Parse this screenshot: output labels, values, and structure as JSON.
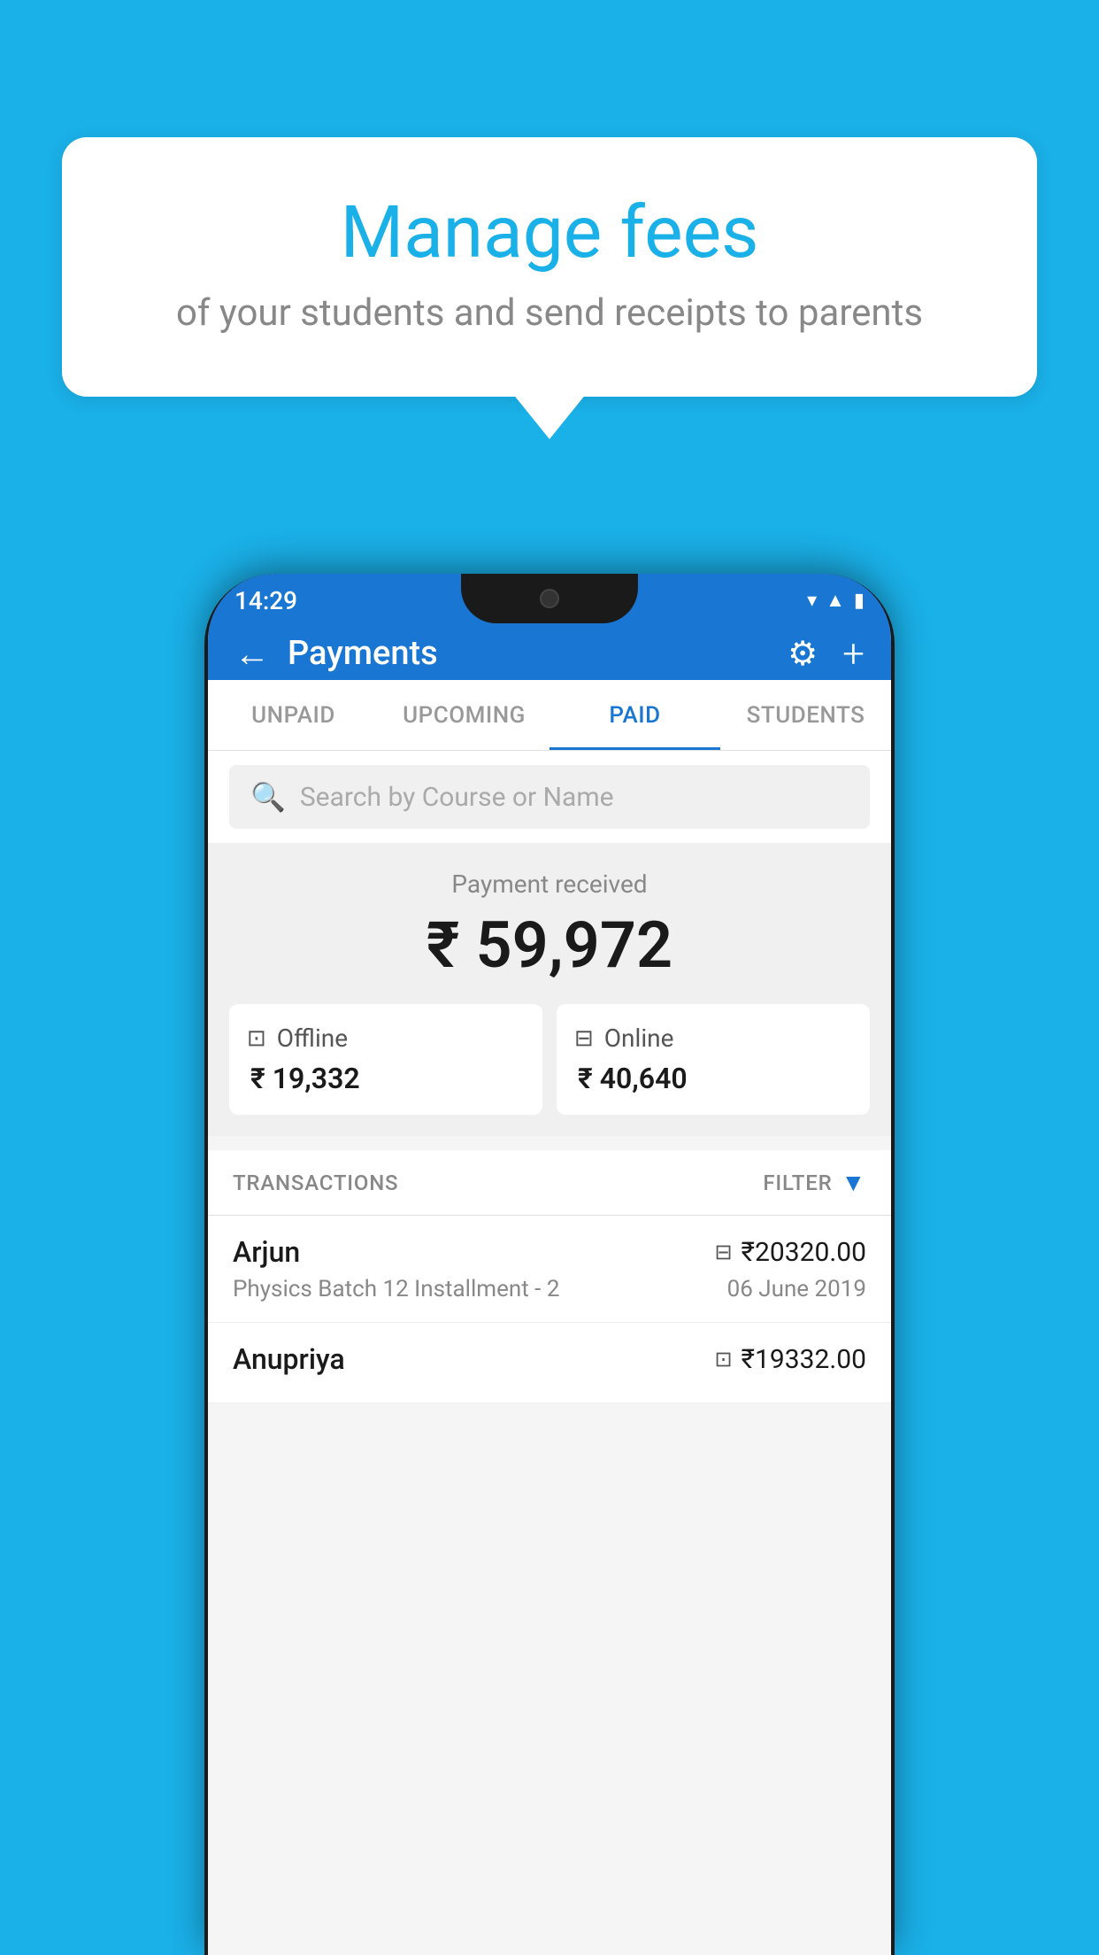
{
  "page": {
    "background_color": "#1ab0e8"
  },
  "speech_bubble": {
    "title": "Manage fees",
    "subtitle": "of your students and send receipts to parents"
  },
  "status_bar": {
    "time": "14:29",
    "icons": [
      "wifi",
      "signal",
      "battery"
    ]
  },
  "header": {
    "title": "Payments",
    "back_label": "←",
    "settings_label": "⚙",
    "add_label": "+"
  },
  "tabs": [
    {
      "label": "UNPAID",
      "active": false
    },
    {
      "label": "UPCOMING",
      "active": false
    },
    {
      "label": "PAID",
      "active": true
    },
    {
      "label": "STUDENTS",
      "active": false
    }
  ],
  "search": {
    "placeholder": "Search by Course or Name"
  },
  "payment_summary": {
    "label": "Payment received",
    "total": "₹ 59,972",
    "offline_label": "Offline",
    "offline_amount": "₹ 19,332",
    "online_label": "Online",
    "online_amount": "₹ 40,640"
  },
  "transactions_section": {
    "label": "TRANSACTIONS",
    "filter_label": "FILTER"
  },
  "transactions": [
    {
      "name": "Arjun",
      "course": "Physics Batch 12 Installment - 2",
      "amount": "₹20320.00",
      "date": "06 June 2019",
      "payment_type": "online"
    },
    {
      "name": "Anupriya",
      "course": "",
      "amount": "₹19332.00",
      "date": "",
      "payment_type": "offline"
    }
  ]
}
